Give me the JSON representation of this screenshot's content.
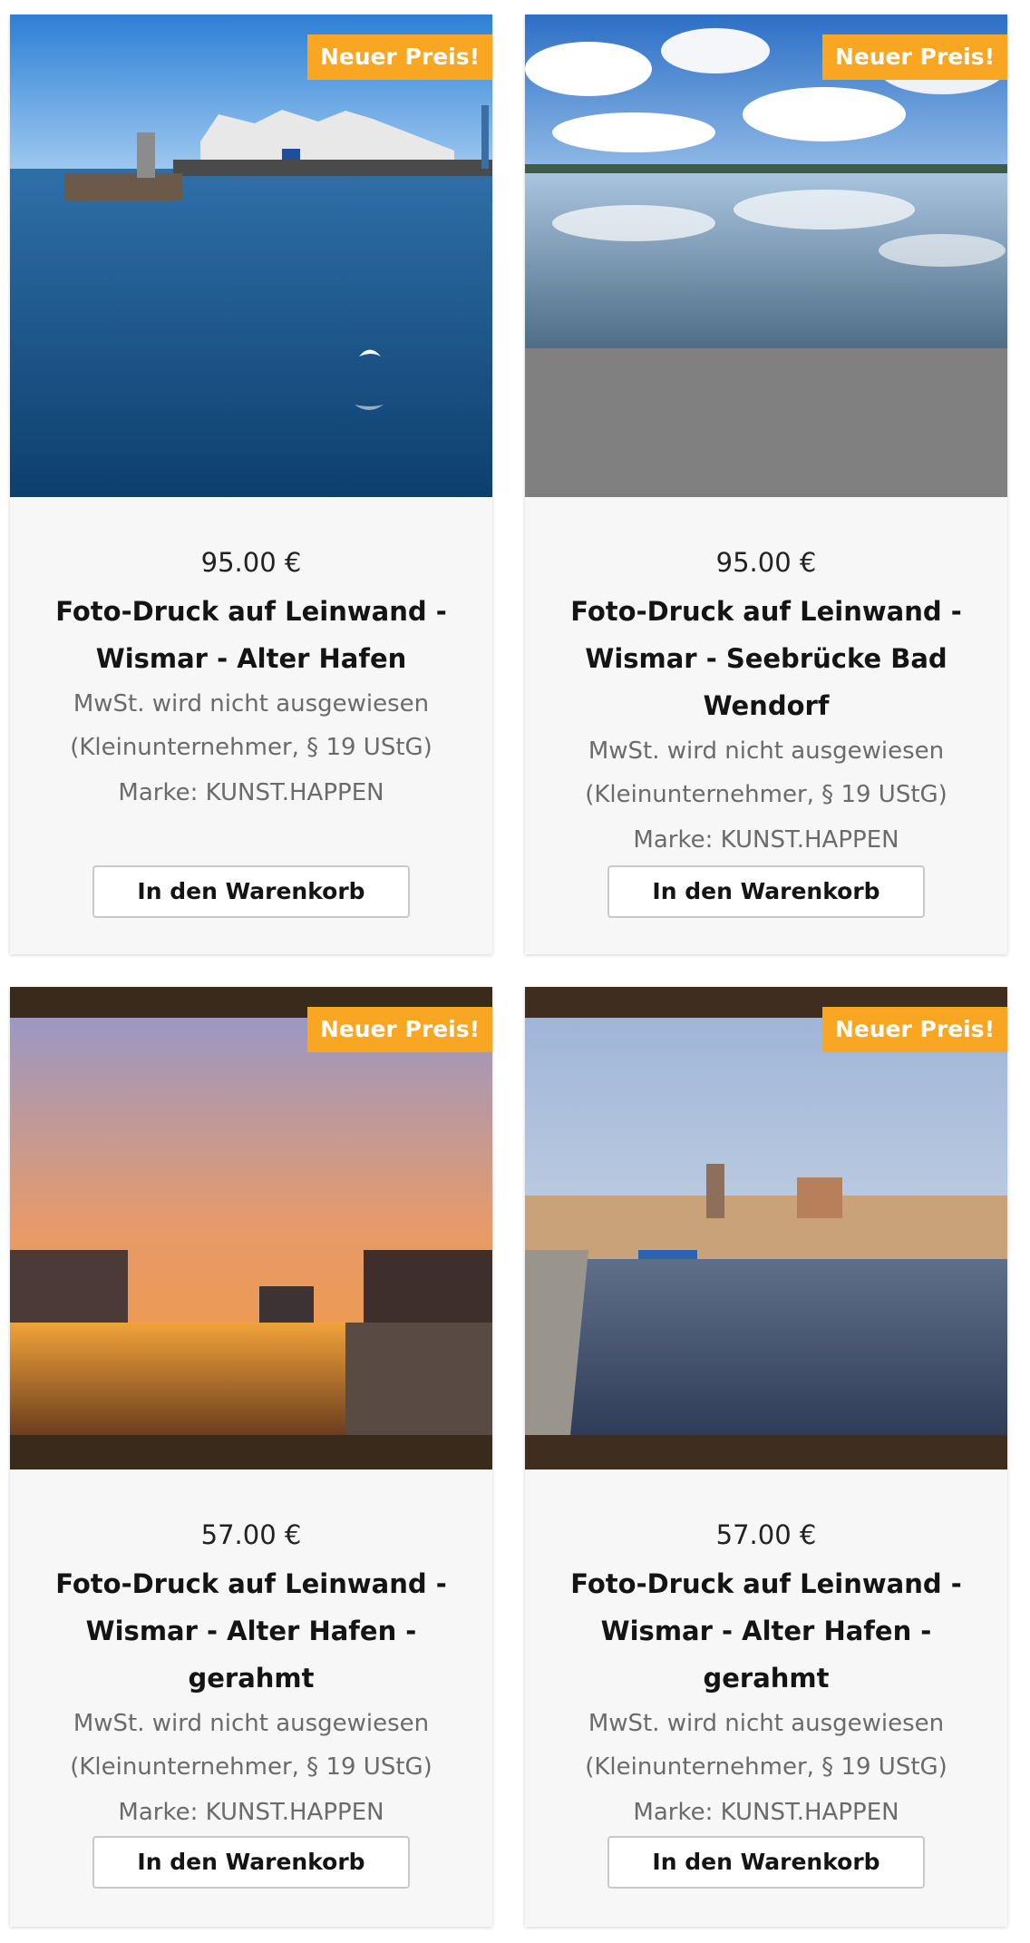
{
  "products": [
    {
      "badge": "Neuer Preis!",
      "price": "95.00 €",
      "title": "Foto-Druck auf Leinwand - Wismar - Alter Hafen",
      "vat_line1": "MwSt. wird nicht ausgewiesen",
      "vat_line2": "(Kleinunternehmer, § 19 UStG)",
      "brand": "Marke: KUNST.HAPPEN",
      "button": "In den Warenkorb"
    },
    {
      "badge": "Neuer Preis!",
      "price": "95.00 €",
      "title": "Foto-Druck auf Leinwand - Wismar - Seebrücke Bad Wendorf",
      "vat_line1": "MwSt. wird nicht ausgewiesen",
      "vat_line2": "(Kleinunternehmer, § 19 UStG)",
      "brand": "Marke: KUNST.HAPPEN",
      "button": "In den Warenkorb"
    },
    {
      "badge": "Neuer Preis!",
      "price": "57.00 €",
      "title": "Foto-Druck auf Leinwand - Wismar - Alter Hafen - gerahmt",
      "vat_line1": "MwSt. wird nicht ausgewiesen",
      "vat_line2": "(Kleinunternehmer, § 19 UStG)",
      "brand": "Marke: KUNST.HAPPEN",
      "button": "In den Warenkorb"
    },
    {
      "badge": "Neuer Preis!",
      "price": "57.00 €",
      "title": "Foto-Druck auf Leinwand - Wismar - Alter Hafen - gerahmt",
      "vat_line1": "MwSt. wird nicht ausgewiesen",
      "vat_line2": "(Kleinunternehmer, § 19 UStG)",
      "brand": "Marke: KUNST.HAPPEN",
      "button": "In den Warenkorb"
    }
  ],
  "colors": {
    "badge_bg": "#f9a623",
    "card_bg": "#f7f7f7",
    "button_border": "#c9c9c9"
  }
}
